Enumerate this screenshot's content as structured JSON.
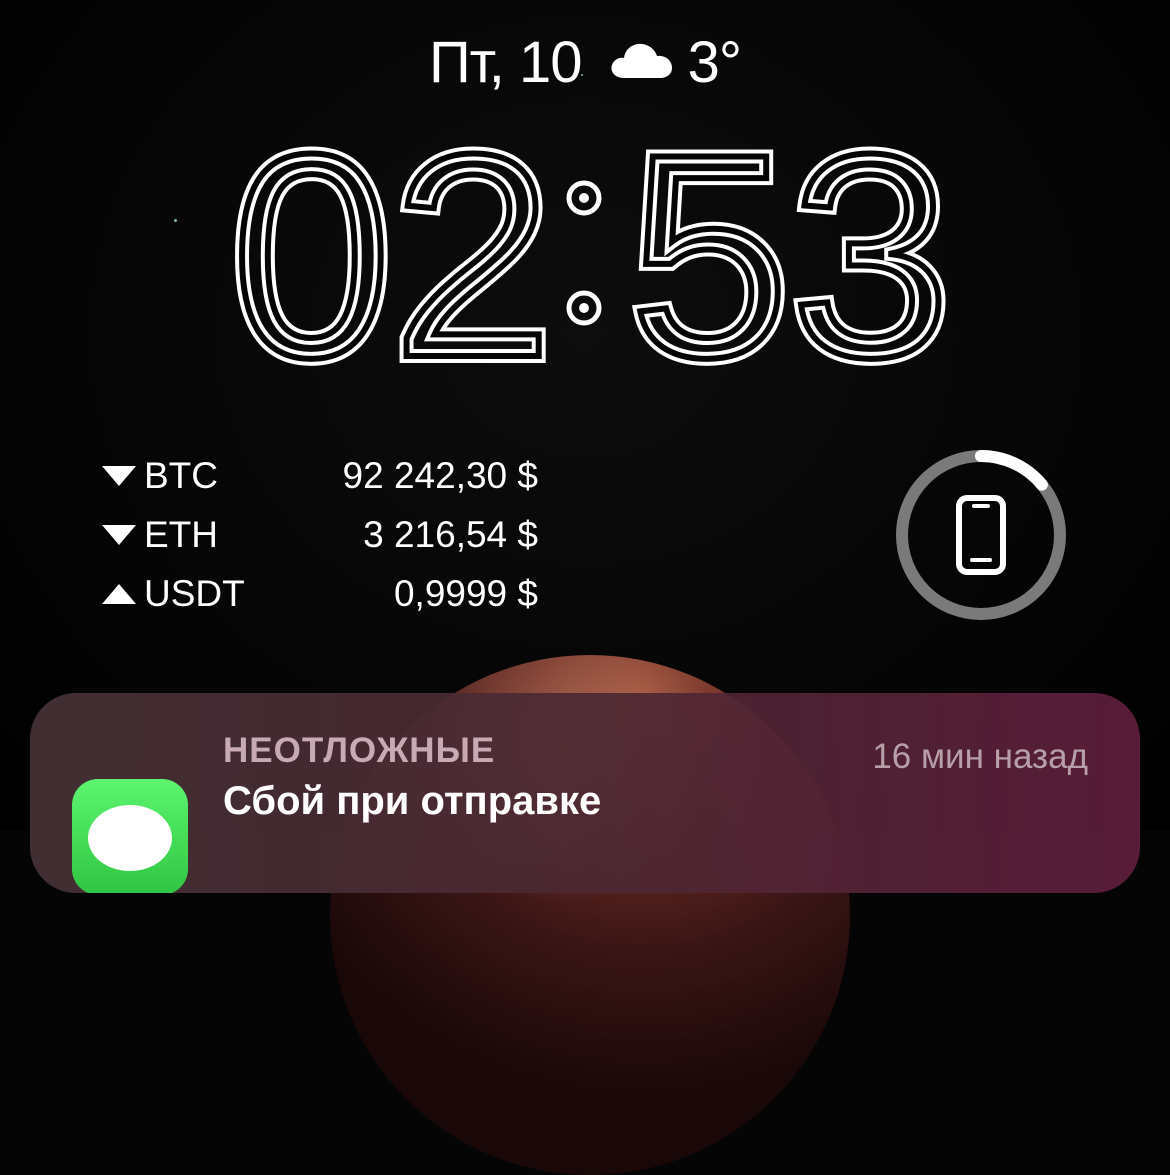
{
  "status": {
    "date": "Пт, 10",
    "weather_icon": "cloud-icon",
    "temperature": "3°"
  },
  "clock": {
    "hours": "02",
    "minutes": "53",
    "separator": ":"
  },
  "crypto_widget": {
    "rows": [
      {
        "symbol": "BTC",
        "price": "92 242,30 $",
        "trend": "down"
      },
      {
        "symbol": "ETH",
        "price": "3 216,54 $",
        "trend": "down"
      },
      {
        "symbol": "USDT",
        "price": "0,9999 $",
        "trend": "up"
      }
    ]
  },
  "battery_widget": {
    "icon": "iphone-icon",
    "level": 0.14
  },
  "notification": {
    "app_icon": "messages-icon",
    "category": "НЕОТЛОЖНЫЕ",
    "time": "16 мин назад",
    "title": "Сбой при отправке"
  },
  "colors": {
    "ring_track": "#7a7a7a",
    "ring_fill": "#ffffff",
    "messages_green": "#34c759"
  }
}
